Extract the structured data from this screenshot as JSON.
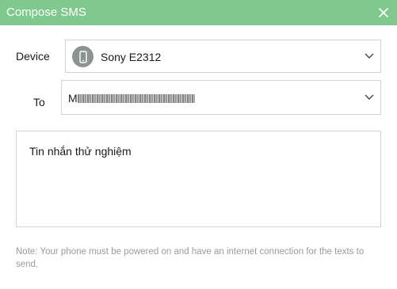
{
  "window": {
    "title": "Compose SMS",
    "close_icon": "close-icon",
    "titlebar_color": "#7fc98f"
  },
  "device": {
    "label": "Device",
    "selected": "Sony E2312",
    "icon": "phone-icon",
    "dropdown_icon": "chevron-down-icon"
  },
  "to": {
    "label": "To",
    "value_visible": "M",
    "value_obscured": true,
    "dropdown_icon": "chevron-down-icon"
  },
  "message": {
    "text": "Tin nhắn thử nghiệm"
  },
  "note": "Note: Your phone must be powered on and have an internet connection for the texts to send."
}
